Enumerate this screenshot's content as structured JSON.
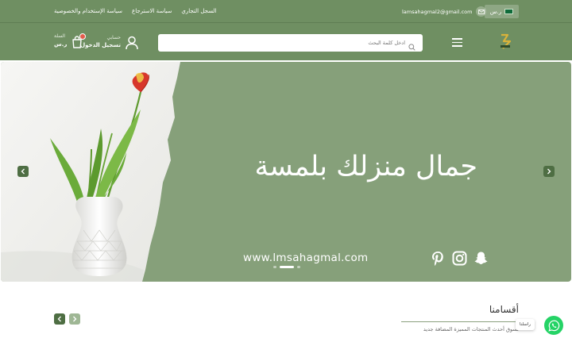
{
  "topbar": {
    "links": [
      "السجل التجاري",
      "سياسة الاسترجاع",
      "سياسة الإستخدام والخصوصية"
    ],
    "email": "lamsahagmal2@gmail.com",
    "currency": "ر.س"
  },
  "header": {
    "search_placeholder": "ادخل كلمة البحث",
    "account_label": "حسابي",
    "login_label": "تسجيل الدخول",
    "cart_label": "السلة",
    "cart_total": "ر.س",
    "cart_count": ""
  },
  "hero": {
    "headline": "جمال منزلك بلمسة",
    "site_url": "www.lmsahagmal.com",
    "socials": [
      "pinterest-icon",
      "instagram-icon",
      "snapchat-icon"
    ],
    "slide_count": 3,
    "active_slide": 1
  },
  "section": {
    "title": "أقسامنا",
    "subtitle": "تسوق أحدث المنتجات المميزة المضافة جديد"
  },
  "chat": {
    "badge": "راسلنا"
  },
  "colors": {
    "header_bg": "#6f8f62",
    "hero_bg": "#86a07a",
    "accent_dark": "#4e6e43",
    "whatsapp": "#25d366"
  }
}
